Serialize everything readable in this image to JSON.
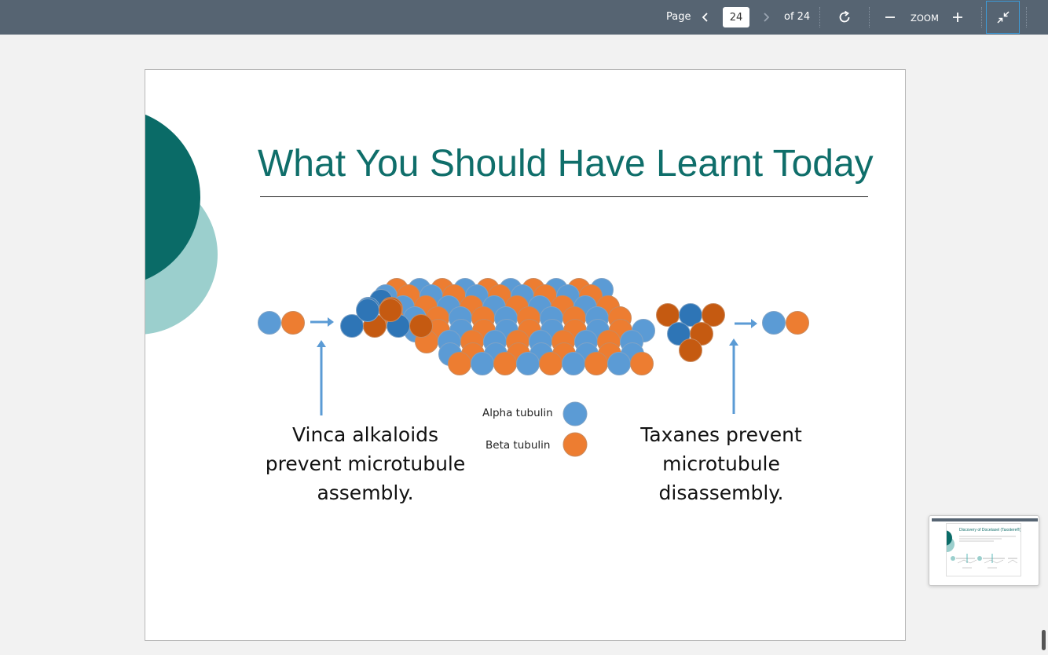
{
  "toolbar": {
    "page_label": "Page",
    "current_page": "24",
    "of_total": "of 24",
    "zoom_label": "ZOOM",
    "icons": [
      "chevron-left-icon",
      "chevron-right-icon",
      "rotate-icon",
      "zoom-out-icon",
      "zoom-in-icon",
      "exit-fullscreen-icon"
    ]
  },
  "slide": {
    "title": "What You Should Have Learnt Today",
    "left_caption": [
      "Vinca alkaloids",
      "prevent microtubule",
      "assembly."
    ],
    "right_caption": [
      "Taxanes prevent",
      "microtubule",
      "disassembly."
    ],
    "legend": [
      {
        "label": "Alpha tubulin",
        "color": "#5b9bd5"
      },
      {
        "label": "Beta tubulin",
        "color": "#ed7d31"
      }
    ]
  },
  "thumbnail": {
    "title": "Discovery of Docetaxel (Taxotere®)"
  },
  "colors": {
    "toolbar": "#566472",
    "accent_teal": "#0f6e6a",
    "light_teal": "#9bcfcd",
    "alpha": "#5b9bd5",
    "alpha_dark": "#2e75b6",
    "beta": "#ed7d31",
    "beta_dark": "#c55a11"
  }
}
